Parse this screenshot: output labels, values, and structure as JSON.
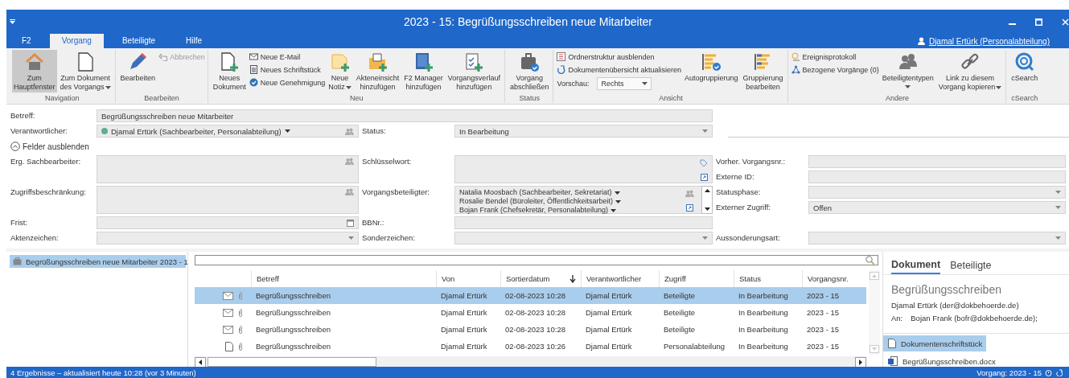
{
  "window": {
    "title": "2023 - 15: Begrüßungsschreiben neue Mitarbeiter"
  },
  "tabs": [
    {
      "label": "F2",
      "selected": false
    },
    {
      "label": "Vorgang",
      "selected": true
    },
    {
      "label": "Beteiligte",
      "selected": false
    },
    {
      "label": "Hilfe",
      "selected": false
    }
  ],
  "user": "Djamal Ertürk (Personalabteilung)",
  "ribbon": {
    "groups": [
      {
        "label": "Navigation",
        "items": [
          {
            "kind": "large",
            "label": "Zum\nHauptfenster",
            "pressed": true
          },
          {
            "kind": "large",
            "label": "Zum Dokument\ndes Vorgangs",
            "pressed": false,
            "dropdown": true
          }
        ]
      },
      {
        "label": "Bearbeiten",
        "items": [
          {
            "kind": "large",
            "label": "Bearbeiten",
            "pressed": false
          },
          {
            "kind": "stack",
            "items": [
              {
                "label": "Abbrechen",
                "disabled": true
              }
            ]
          }
        ]
      },
      {
        "label": "Neu",
        "items": [
          {
            "kind": "large",
            "label": "Neues\nDokument",
            "pressed": false
          },
          {
            "kind": "stack",
            "items": [
              {
                "label": "Neue E-Mail",
                "disabled": false
              },
              {
                "label": "Neues Schriftstück",
                "disabled": false
              },
              {
                "label": "Neue Genehmigung",
                "disabled": false
              }
            ]
          },
          {
            "kind": "large",
            "label": "Neue\nNotiz",
            "pressed": false,
            "dropdown": true
          },
          {
            "kind": "large",
            "label": "Akteneinsicht\nhinzufügen",
            "pressed": false
          },
          {
            "kind": "large",
            "label": "F2 Manager\nhinzufügen",
            "pressed": false
          },
          {
            "kind": "large",
            "label": "Vorgangsverlauf\nhinzufügen",
            "pressed": false
          }
        ]
      },
      {
        "label": "Status",
        "items": [
          {
            "kind": "large",
            "label": "Vorgang\nabschließen",
            "pressed": false
          }
        ]
      },
      {
        "label": "Ansicht",
        "items": [
          {
            "kind": "stack",
            "items": [
              {
                "label": "Ordnerstruktur ausblenden",
                "disabled": false
              },
              {
                "label": "Dokumentenübersicht aktualisieren",
                "disabled": false
              },
              {
                "kind": "combo",
                "label": "Vorschau:",
                "value": "Rechts"
              }
            ]
          },
          {
            "kind": "large",
            "label": "Autogruppierung",
            "pressed": false
          },
          {
            "kind": "large",
            "label": "Gruppierung\nbearbeiten",
            "pressed": false
          }
        ]
      },
      {
        "label": "Andere",
        "items": [
          {
            "kind": "stack",
            "items": [
              {
                "label": "Ereignisprotokoll",
                "disabled": false
              },
              {
                "label": "Bezogene Vorgänge (0)",
                "disabled": false
              }
            ]
          },
          {
            "kind": "large",
            "label": "Beteiligtentypen",
            "pressed": false,
            "dropdown": true
          },
          {
            "kind": "large",
            "label": "Link zu diesem\nVorgang kopieren",
            "pressed": false,
            "dropdown": true
          }
        ]
      },
      {
        "label": "cSearch",
        "items": [
          {
            "kind": "large",
            "label": "cSearch",
            "pressed": false
          }
        ]
      }
    ]
  },
  "form": {
    "subject": {
      "label": "Betreff:",
      "value": "Begrüßungsschreiben neue Mitarbeiter"
    },
    "responsible": {
      "label": "Verantwortlicher:",
      "value": "Djamal Ertürk (Sachbearbeiter, Personalabteilung)",
      "color": "#5fae8c"
    },
    "status": {
      "label": "Status:",
      "value": "In Bearbeitung"
    },
    "toggle": {
      "label": "Felder ausblenden",
      "expanded": true
    },
    "fields": [
      {
        "label": "Erg. Sachbearbeiter:",
        "kind": "people"
      },
      {
        "label": "Schlüsselwort:",
        "kind": "keyword"
      },
      {
        "label": "Vorher. Vorgangsnr.:",
        "kind": "text"
      },
      {
        "label": "Externe ID:",
        "kind": "text"
      },
      {
        "label": "Zugriffsbeschränkung:",
        "kind": "people"
      },
      {
        "label": "Vorgangsbeteiligter:",
        "kind": "participants",
        "values": [
          "Natalia Moosbach (Sachbearbeiter, Sekretariat)",
          "Rosalie Bendel (Büroleiter, Öffentlichkeitsarbeit)",
          "Bojan Frank (Chefsekretär, Personalabteilung)"
        ]
      },
      {
        "label": "Statusphase:",
        "kind": "dropdown"
      },
      {
        "label": "Externer Zugriff:",
        "kind": "dropdown",
        "value": "Offen"
      },
      {
        "label": "Frist:",
        "kind": "date"
      },
      {
        "label": "BBNr.:",
        "kind": "text"
      },
      {
        "label": "Aktenzeichen:",
        "kind": "dropdown"
      },
      {
        "label": "Sonderzeichen:",
        "kind": "dropdown"
      },
      {
        "label": "Aussonderungsart:",
        "kind": "dropdown"
      }
    ]
  },
  "tree": {
    "items": [
      {
        "label": "Begrüßungsschreiben neue Mitarbeiter 2023 - 1",
        "selected": true
      }
    ]
  },
  "table": {
    "columns": [
      {
        "label": "Betreff",
        "sorted": false
      },
      {
        "label": "Von",
        "sorted": false
      },
      {
        "label": "Sortierdatum",
        "sorted": true
      },
      {
        "label": "Verantwortlicher",
        "sorted": false
      },
      {
        "label": "Zugriff",
        "sorted": false
      },
      {
        "label": "Status",
        "sorted": false
      },
      {
        "label": "Vorgangsnr.",
        "sorted": false
      }
    ],
    "rows": [
      {
        "kind": "mail",
        "selected": true,
        "cells": [
          "Begrüßungsschreiben",
          "Djamal Ertürk",
          "02-08-2023 10:28",
          "Djamal Ertürk",
          "Beteiligte",
          "In Bearbeitung",
          "2023 - 15"
        ]
      },
      {
        "kind": "mail",
        "selected": false,
        "cells": [
          "Begrüßungsschreiben",
          "Djamal Ertürk",
          "02-08-2023 10:28",
          "Djamal Ertürk",
          "Beteiligte",
          "In Bearbeitung",
          "2023 - 15"
        ]
      },
      {
        "kind": "mail",
        "selected": false,
        "cells": [
          "Begrüßungsschreiben",
          "Djamal Ertürk",
          "02-08-2023 10:28",
          "Djamal Ertürk",
          "Beteiligte",
          "In Bearbeitung",
          "2023 - 15"
        ]
      },
      {
        "kind": "document",
        "selected": false,
        "cells": [
          "Begrüßungsschreiben",
          "Djamal Ertürk",
          "02-08-2023 10:26",
          "Djamal Ertürk",
          "Personalabteilung",
          "In Bearbeitung",
          "2023 - 15"
        ]
      }
    ]
  },
  "preview": {
    "tabs": [
      {
        "label": "Dokument",
        "selected": true
      },
      {
        "label": "Beteiligte",
        "selected": false
      }
    ],
    "title": "Begrüßungsschreiben",
    "from": "Djamal Ertürk (der@dokbehoerde.de)",
    "to_label": "An:",
    "to": "Bojan Frank (bofr@dokbehoerde.de);",
    "attachments": [
      {
        "label": "Dokumentenschriftstück",
        "kind": "document",
        "selected": true
      },
      {
        "label": "Begrüßungsschreiben.docx",
        "kind": "word",
        "selected": false
      }
    ]
  },
  "status_bar": {
    "left": "4 Ergebnisse – aktualisiert heute 10:28 (vor 3 Minuten)",
    "right": "Vorgang: 2023 - 15"
  }
}
